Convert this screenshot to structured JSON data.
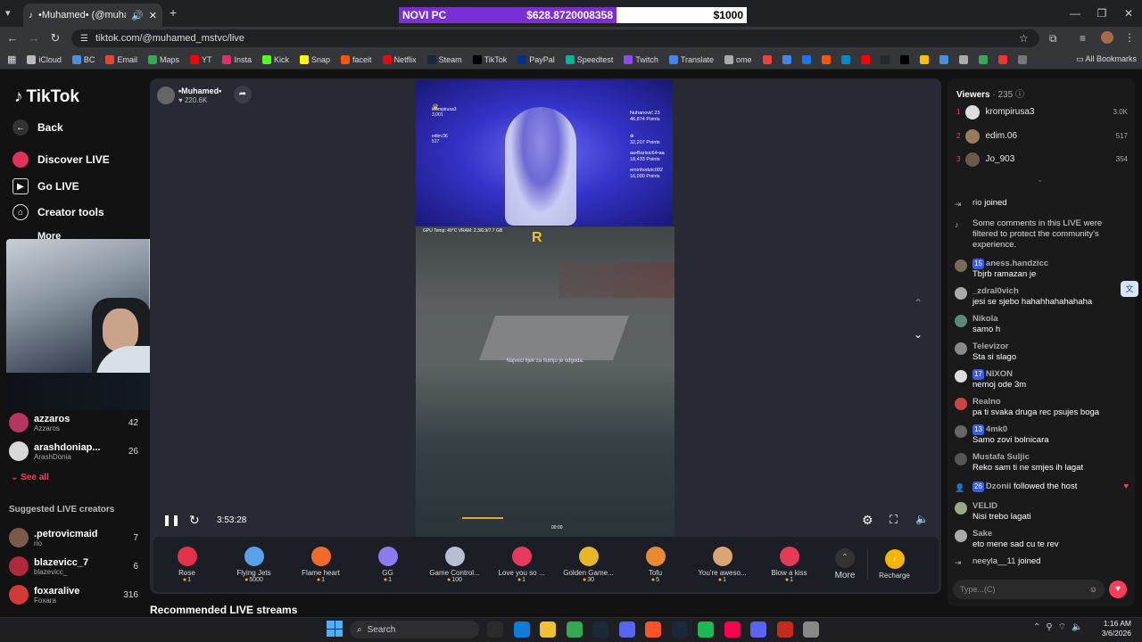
{
  "browser": {
    "tab_title": "•Muhamed• (@muhamed_",
    "donation_label": "NOVI PC",
    "donation_current": "$628.8720008358",
    "donation_goal": "$1000",
    "url": "tiktok.com/@muhamed_mstvc/live",
    "bookmarks": [
      "iCloud",
      "BC",
      "Email",
      "Maps",
      "YT",
      "Insta",
      "Kick",
      "Snap",
      "faceit",
      "Netflix",
      "Steam",
      "TikTok",
      "PayPal",
      "Speedtest",
      "Twitch",
      "Translate",
      "ome"
    ],
    "all_bookmarks": "All Bookmarks"
  },
  "sidebar": {
    "logo": "TikTok",
    "back": "Back",
    "discover": "Discover LIVE",
    "golive": "Go LIVE",
    "creator_tools": "Creator tools",
    "more": "More",
    "following": [
      {
        "name": "azzaros",
        "sub": "Azzaros",
        "count": "42"
      },
      {
        "name": "arashdoniap...",
        "sub": "ArashDonia",
        "count": "26"
      }
    ],
    "see_all": "See all",
    "suggested_title": "Suggested LIVE creators",
    "suggested": [
      {
        "name": ".petrovicmaid",
        "sub": "rio",
        "count": "7"
      },
      {
        "name": "blazevicc_7",
        "sub": "blazevicc_",
        "count": "6"
      },
      {
        "name": "foxaralive",
        "sub": "Foxara",
        "count": "316"
      }
    ],
    "recommended": "Recommended LIVE streams"
  },
  "stream": {
    "host_name": "•Muhamed•",
    "host_likes": "220.6K",
    "time": "3:53:28",
    "overlay_lb_left": [
      {
        "name": "krompirusa3",
        "pts": "3,001"
      },
      {
        "name": "edim.06",
        "pts": "517"
      }
    ],
    "overlay_lb_right": [
      {
        "name": "Nuhanović 23",
        "pts": "46,874 Points"
      },
      {
        "name": "⊕",
        "pts": "32,207 Points"
      },
      {
        "name": "aa•Barisic64•aa",
        "pts": "18,433 Points"
      },
      {
        "name": "eminhodzic002",
        "pts": "16,090 Points"
      }
    ],
    "hud_text": "GPU Temp: 49°C  VRAM: 2.3/6.9/7.7 GB",
    "game_caption": "Najveći lijek za šutnju je odgoda.",
    "game_timer": "00:00"
  },
  "gifts": [
    {
      "name": "Rose",
      "cost": "1",
      "color": "#e0324b"
    },
    {
      "name": "Flying Jets",
      "cost": "5000",
      "color": "#5aa2e8"
    },
    {
      "name": "Flame heart",
      "cost": "1",
      "color": "#f06a2c"
    },
    {
      "name": "GG",
      "cost": "1",
      "color": "#8a7cf0"
    },
    {
      "name": "Game Control...",
      "cost": "100",
      "color": "#b8bfd0"
    },
    {
      "name": "Love you so ...",
      "cost": "1",
      "color": "#e8395e"
    },
    {
      "name": "Golden Game...",
      "cost": "30",
      "color": "#e8b526"
    },
    {
      "name": "Tofu",
      "cost": "5",
      "color": "#e98a33"
    },
    {
      "name": "You're aweso...",
      "cost": "1",
      "color": "#d9a572"
    },
    {
      "name": "Blow a kiss",
      "cost": "1",
      "color": "#e33b55"
    }
  ],
  "gift_more": "More",
  "recharge": "Recharge",
  "chat": {
    "viewers_label": "Viewers",
    "viewers_count": "235",
    "top_viewers": [
      {
        "rank": "1",
        "name": "krompirusa3",
        "score": "3.0K"
      },
      {
        "rank": "2",
        "name": "edim.06",
        "score": "517"
      },
      {
        "rank": "3",
        "name": "Jo_903",
        "score": "354"
      }
    ],
    "messages": [
      {
        "name": "rio",
        "text": "joined",
        "type": "join"
      },
      {
        "name": "",
        "text": "Some comments in this LIVE were filtered to protect the community's experience.",
        "type": "system"
      },
      {
        "name": "aness.handzicc",
        "badge": "15",
        "text": "Tbjrb ramazan je"
      },
      {
        "name": "_zdral0vich",
        "text": "jesi se sjebo hahahhahahahaha"
      },
      {
        "name": "Nikola",
        "text": "samo h"
      },
      {
        "name": "Televizor",
        "text": "Sta si slago"
      },
      {
        "name": "NIXON",
        "badge": "17",
        "text": "nemoj ode 3m"
      },
      {
        "name": "Realno",
        "text": "pa ti svaka druga rec psujes boga"
      },
      {
        "name": "4mk0",
        "badge": "13",
        "text": "Samo zovi bolnicara"
      },
      {
        "name": "Mustafa Suljic",
        "text": "Reko sam ti ne smjes ih lagat"
      },
      {
        "name": "Dzonii",
        "badge": "26",
        "text": "followed the host",
        "type": "follow"
      },
      {
        "name": "VELID",
        "text": "Nisi trebo lagati"
      },
      {
        "name": "Sake",
        "text": "eto mene sad cu te rev"
      },
      {
        "name": "neeyla__11",
        "text": "joined",
        "type": "join"
      }
    ],
    "input_placeholder": "Type...(C)"
  },
  "taskbar": {
    "search": "Search",
    "time": "1:16 AM",
    "date": "3/6/2026"
  }
}
